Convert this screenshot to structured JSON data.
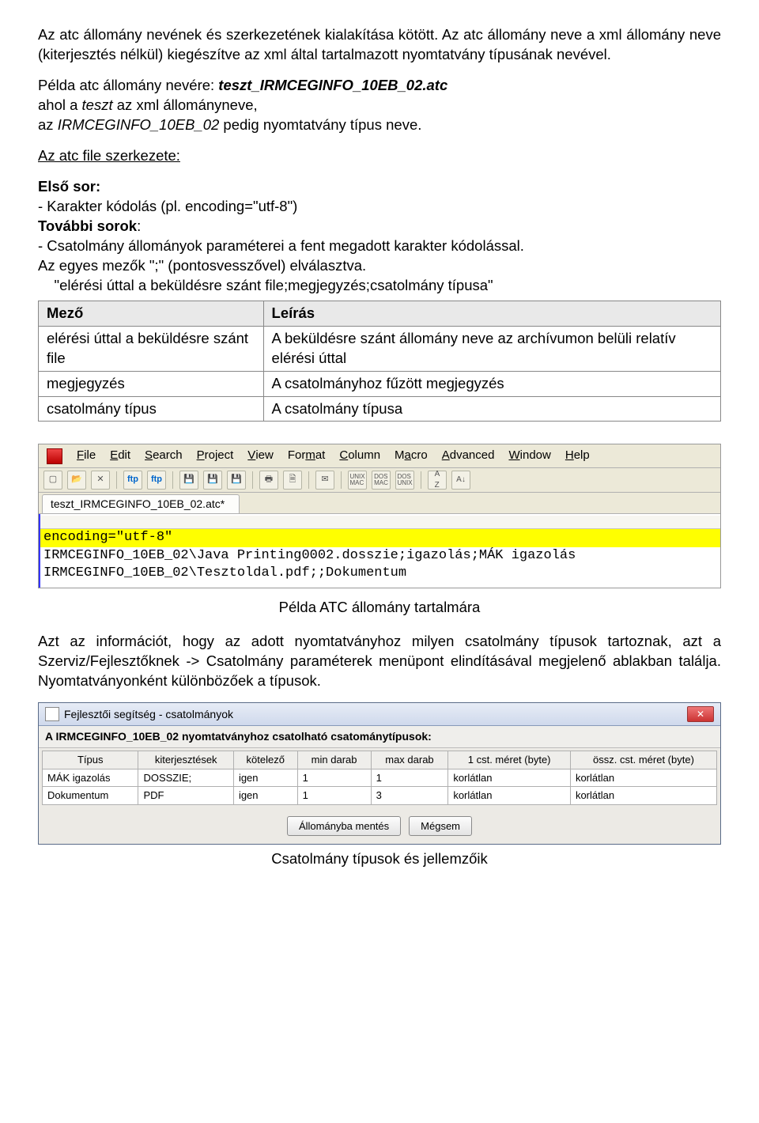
{
  "para1_a": "Az atc állomány nevének és szerkezetének kialakítása kötött. Az atc állomány neve a xml állomány neve (kiterjesztés nélkül) kiegészítve az xml által tartalmazott nyomtatvány típusának nevével.",
  "para2_a": "Példa atc állomány nevére: ",
  "para2_b": "teszt_IRMCEGINFO_10EB_02.atc",
  "para2_c": "ahol a ",
  "para2_d": "teszt",
  "para2_e": " az xml állományneve,",
  "para2_f": "az ",
  "para2_g": "IRMCEGINFO_10EB_02",
  "para2_h": " pedig nyomtatvány típus neve.",
  "heading_struct": "Az atc file szerkezete:",
  "first_row_label": "Első sor:",
  "first_row_item": "-  Karakter kódolás (pl. encoding=\"utf-8\")",
  "further_label": "További sorok",
  "further_colon": ":",
  "further_item": "- Csatolmány állományok paraméterei a fent megadott karakter kódolással.",
  "further_line2": "Az egyes mezők \";\" (pontosvesszővel) elválasztva.",
  "further_line3": "    \"elérési úttal a beküldésre szánt file;megjegyzés;csatolmány típusa\"",
  "fields_table": {
    "head": [
      "Mező",
      "Leírás"
    ],
    "rows": [
      [
        "elérési úttal a beküldésre szánt file",
        "A beküldésre szánt állomány neve az archívumon belüli relatív elérési úttal"
      ],
      [
        "megjegyzés",
        "A csatolmányhoz fűzött megjegyzés"
      ],
      [
        "csatolmány típus",
        "A csatolmány típusa"
      ]
    ]
  },
  "editor": {
    "menus": [
      "File",
      "Edit",
      "Search",
      "Project",
      "View",
      "Format",
      "Column",
      "Macro",
      "Advanced",
      "Window",
      "Help"
    ],
    "tab": "teszt_IRMCEGINFO_10EB_02.atc*",
    "line1": "encoding=\"utf-8\"",
    "line2": "IRMCEGINFO_10EB_02\\Java Printing0002.dosszie;igazolás;MÁK igazolás",
    "line3": "IRMCEGINFO_10EB_02\\Tesztoldal.pdf;;Dokumentum"
  },
  "caption1": "Példa ATC állomány tartalmára",
  "para3": "Azt az információt, hogy az adott nyomtatványhoz milyen csatolmány típusok tartoznak, azt a Szerviz/Fejlesztőknek -> Csatolmány paraméterek menüpont elindításával megjelenő ablakban találja. Nyomtatványonként különbözőek a típusok.",
  "dialog": {
    "title": "Fejlesztői segítség - csatolmányok",
    "heading": "A IRMCEGINFO_10EB_02 nyomtatványhoz csatolható csatománytípusok:",
    "columns": [
      "Típus",
      "kiterjesztések",
      "kötelező",
      "min darab",
      "max darab",
      "1 cst. méret (byte)",
      "össz. cst. méret (byte)"
    ],
    "rows": [
      [
        "MÁK igazolás",
        "DOSSZIE;",
        "igen",
        "1",
        "1",
        "korlátlan",
        "korlátlan"
      ],
      [
        "Dokumentum",
        "PDF",
        "igen",
        "1",
        "3",
        "korlátlan",
        "korlátlan"
      ]
    ],
    "btn_save": "Állományba mentés",
    "btn_cancel": "Mégsem"
  },
  "caption2": "Csatolmány típusok és jellemzőik"
}
